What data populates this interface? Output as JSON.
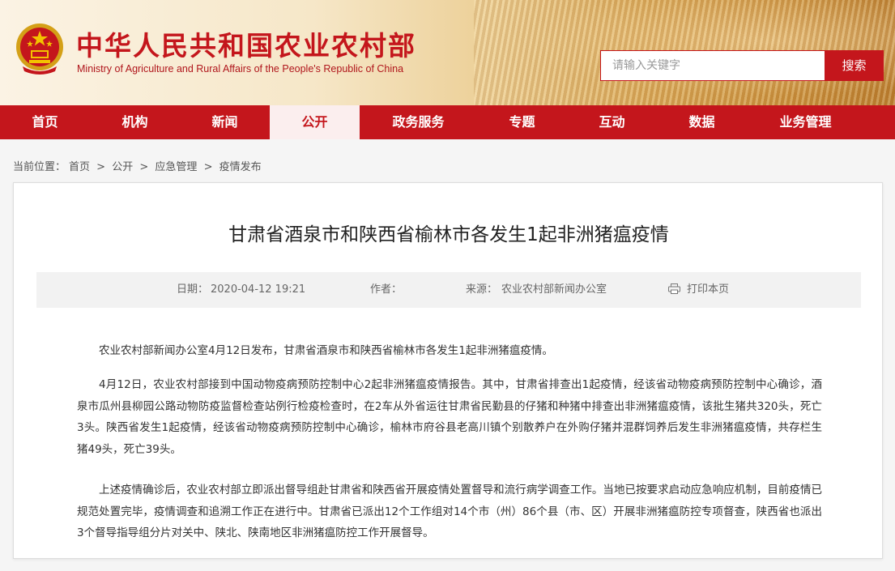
{
  "header": {
    "title": "中华人民共和国农业农村部",
    "subtitle": "Ministry of Agriculture and Rural Affairs of the People's Republic of China",
    "search_placeholder": "请输入关键字",
    "search_button": "搜索",
    "accent_color": "#c4161c"
  },
  "nav": {
    "items": [
      {
        "label": "首页"
      },
      {
        "label": "机构"
      },
      {
        "label": "新闻"
      },
      {
        "label": "公开"
      },
      {
        "label": "政务服务"
      },
      {
        "label": "专题"
      },
      {
        "label": "互动"
      },
      {
        "label": "数据"
      },
      {
        "label": "业务管理"
      }
    ],
    "active": "公开"
  },
  "breadcrumb": {
    "prefix": "当前位置：",
    "items": [
      "首页",
      "公开",
      "应急管理",
      "疫情发布"
    ],
    "separator": ">"
  },
  "article": {
    "title": "甘肃省酒泉市和陕西省榆林市各发生1起非洲猪瘟疫情",
    "meta": {
      "date_label": "日期：",
      "date": "2020-04-12 19:21",
      "author_label": "作者：",
      "source_label": "来源：",
      "source": "农业农村部新闻办公室",
      "print_label": "打印本页"
    },
    "paragraphs": [
      "农业农村部新闻办公室4月12日发布，甘肃省酒泉市和陕西省榆林市各发生1起非洲猪瘟疫情。",
      "4月12日，农业农村部接到中国动物疫病预防控制中心2起非洲猪瘟疫情报告。其中，甘肃省排查出1起疫情，经该省动物疫病预防控制中心确诊，酒泉市瓜州县柳园公路动物防疫监督检查站例行检疫检查时，在2车从外省运往甘肃省民勤县的仔猪和种猪中排查出非洲猪瘟疫情，该批生猪共320头，死亡3头。陕西省发生1起疫情，经该省动物疫病预防控制中心确诊，榆林市府谷县老高川镇个别散养户在外购仔猪并混群饲养后发生非洲猪瘟疫情，共存栏生猪49头，死亡39头。",
      "上述疫情确诊后，农业农村部立即派出督导组赴甘肃省和陕西省开展疫情处置督导和流行病学调查工作。当地已按要求启动应急响应机制，目前疫情已规范处置完毕，疫情调查和追溯工作正在进行中。甘肃省已派出12个工作组对14个市（州）86个县（市、区）开展非洲猪瘟防控专项督查，陕西省也派出3个督导指导组分片对关中、陕北、陕南地区非洲猪瘟防控工作开展督导。"
    ]
  }
}
